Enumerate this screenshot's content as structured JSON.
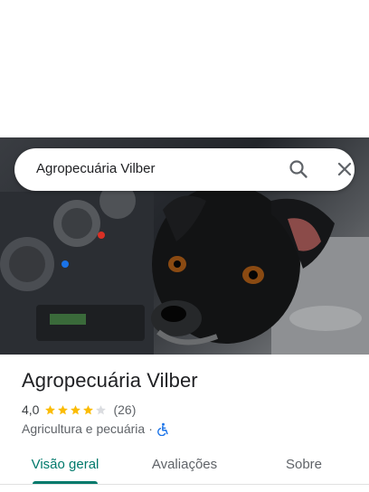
{
  "search": {
    "query": "Agropecuária Vilber"
  },
  "place": {
    "name": "Agropecuária Vilber",
    "rating": "4,0",
    "stars_filled": 4,
    "stars_total": 5,
    "review_count": "(26)",
    "category": "Agricultura e pecuária",
    "separator": "·"
  },
  "tabs": [
    {
      "label": "Visão geral",
      "active": true
    },
    {
      "label": "Avaliações",
      "active": false
    },
    {
      "label": "Sobre",
      "active": false
    }
  ],
  "icons": {
    "search": "search-icon",
    "close": "close-icon",
    "accessibility": "wheelchair-icon",
    "star": "star-icon"
  },
  "colors": {
    "accent": "#00796b",
    "star": "#fbbc04",
    "star_empty": "#dadce0",
    "accessibility_icon": "#1a73e8"
  }
}
